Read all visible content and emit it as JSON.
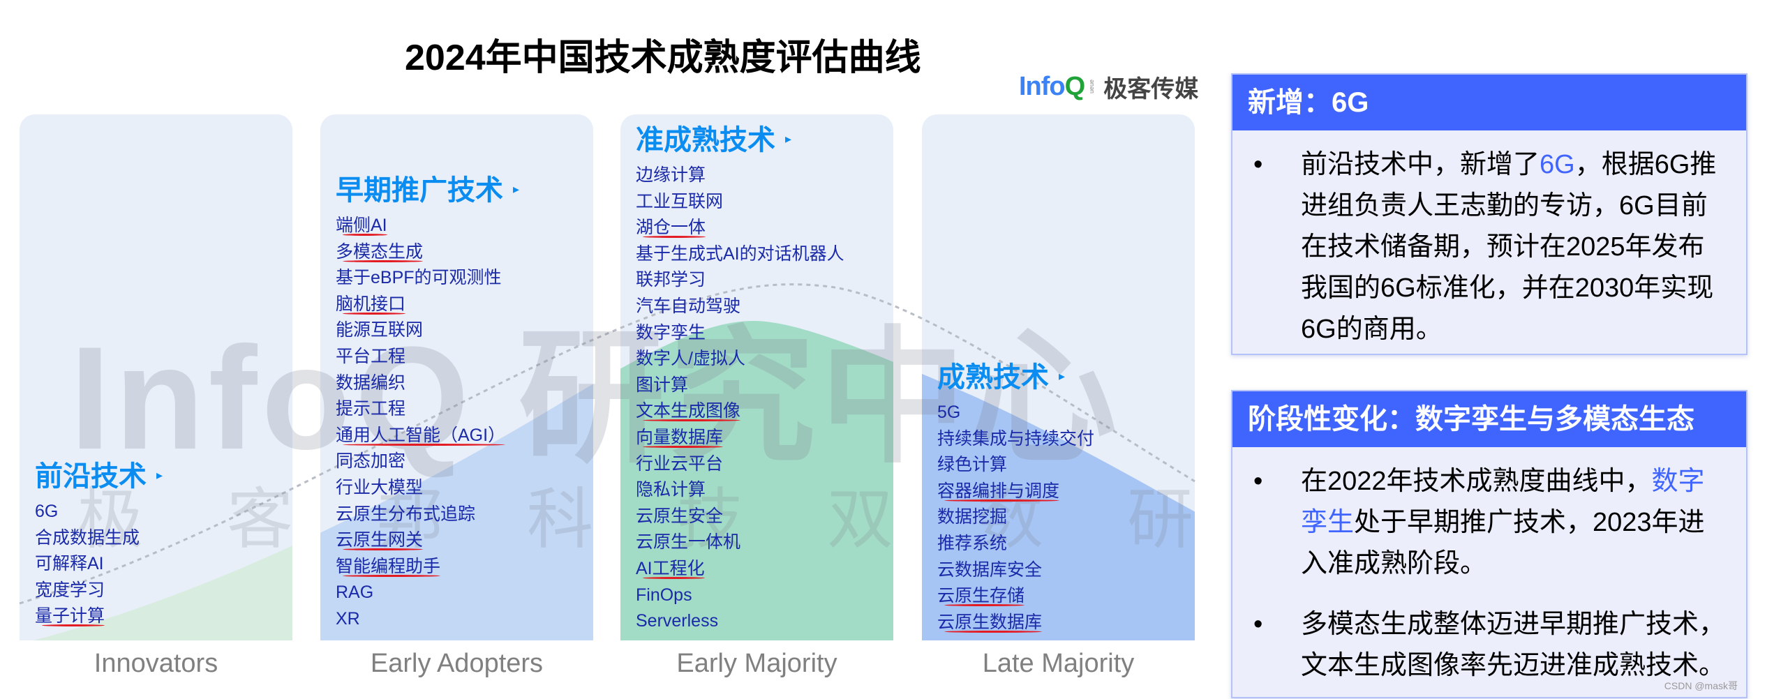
{
  "title": "2024年中国技术成熟度评估曲线",
  "logo": {
    "brand": "Info",
    "brand_q": "Q",
    "queue": "ueue",
    "cn": "极客传媒"
  },
  "watermark": {
    "big": "InfoQ 研究中心",
    "small": "极客邦科技双数研究院"
  },
  "colors": {
    "accent": "#0a8cf0",
    "item_text": "#1a2aa8",
    "box_header": "#4065ff",
    "underline": "#e31b23",
    "innovators_fill": "#d8ecdf",
    "early_adopters_fill": "#c2d8f5",
    "early_majority_fill": "#a3dcc6",
    "late_majority_fill": "#a7c5f4"
  },
  "columns": [
    {
      "heading": "前沿技术",
      "arrow": "▸",
      "stage": "Innovators",
      "items": [
        "6G",
        "合成数据生成",
        "可解释AI",
        "宽度学习",
        "量子计算"
      ],
      "underlined": [
        "量子计算"
      ]
    },
    {
      "heading": "早期推广技术",
      "arrow": "▸",
      "stage": "Early Adopters",
      "items": [
        "端侧AI",
        "多模态生成",
        "基于eBPF的可观测性",
        "脑机接口",
        "能源互联网",
        "平台工程",
        "数据编织",
        "提示工程",
        "通用人工智能（AGI）",
        "同态加密",
        "行业大模型",
        "云原生分布式追踪",
        "云原生网关",
        "智能编程助手",
        "RAG",
        "XR"
      ],
      "underlined": [
        "端侧AI",
        "多模态生成",
        "脑机接口",
        "通用人工智能（AGI）",
        "云原生网关",
        "智能编程助手"
      ]
    },
    {
      "heading": "准成熟技术",
      "arrow": "▸",
      "stage": "Early Majority",
      "items": [
        "边缘计算",
        "工业互联网",
        "湖仓一体",
        "基于生成式AI的对话机器人",
        "联邦学习",
        "汽车自动驾驶",
        "数字孪生",
        "数字人/虚拟人",
        "图计算",
        "文本生成图像",
        "向量数据库",
        "行业云平台",
        "隐私计算",
        "云原生安全",
        "云原生一体机",
        "AI工程化",
        "FinOps",
        "Serverless"
      ],
      "underlined": [
        "湖仓一体",
        "文本生成图像",
        "向量数据库",
        "AI工程化"
      ]
    },
    {
      "heading": "成熟技术",
      "arrow": "▸",
      "stage": "Late Majority",
      "items": [
        "5G",
        "持续集成与持续交付",
        "绿色计算",
        "容器编排与调度",
        "数据挖掘",
        "推荐系统",
        "云数据库安全",
        "云原生存储",
        "云原生数据库"
      ],
      "underlined": [
        "容器编排与调度",
        "云原生存储",
        "云原生数据库"
      ]
    }
  ],
  "box1": {
    "header": "新增：6G",
    "bullets": [
      {
        "pre": "前沿技术中，新增了",
        "hl": "6G",
        "post": "，根据6G推进组负责人王志勤的专访，6G目前在技术储备期，预计在2025年发布我国的6G标准化，并在2030年实现6G的商用。"
      }
    ]
  },
  "box2": {
    "header": "阶段性变化：数字孪生与多模态生态",
    "bullets": [
      {
        "pre": "在2022年技术成熟度曲线中，",
        "hl": "数字孪生",
        "post": "处于早期推广技术，2023年进入准成熟阶段。"
      },
      {
        "pre": "多模态生成整体迈进早期推广技术，文本生成图像率先迈进准成熟技术。",
        "hl": "",
        "post": ""
      }
    ]
  },
  "credit": "CSDN @mask哥"
}
